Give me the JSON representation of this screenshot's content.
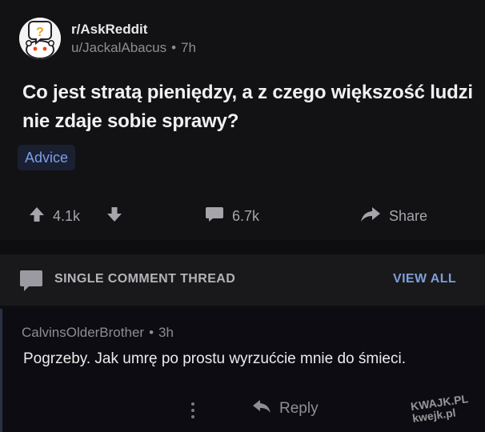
{
  "post": {
    "subreddit": "r/AskReddit",
    "author": "u/JackalAbacus",
    "separator": "•",
    "age": "7h",
    "title": "Co jest stratą pieniędzy, a z czego większość ludzi nie zdaje sobie sprawy?",
    "flair": "Advice",
    "votes": "4.1k",
    "comment_count": "6.7k",
    "share_label": "Share",
    "avatar_mark": "?"
  },
  "thread": {
    "label": "SINGLE COMMENT THREAD",
    "view_all": "VIEW ALL"
  },
  "comment": {
    "author": "CalvinsOlderBrother",
    "separator": "•",
    "age": "3h",
    "body": "Pogrzeby. Jak umrę po prostu wyrzućcie mnie do śmieci.",
    "reply_label": "Reply"
  },
  "watermark": {
    "line1": "KWAJK.PL",
    "line2": "kwejk.pl"
  },
  "colors": {
    "background": "#0e0e10",
    "post_background": "#121215",
    "flair_text": "#7c9ee8",
    "view_all": "#7e9fd8"
  },
  "icons": [
    "snoo-question-avatar",
    "upvote-arrow-icon",
    "downvote-arrow-icon",
    "comment-bubble-icon",
    "share-arrow-icon",
    "thread-bubble-icon",
    "more-options-icon",
    "reply-arrow-icon"
  ]
}
